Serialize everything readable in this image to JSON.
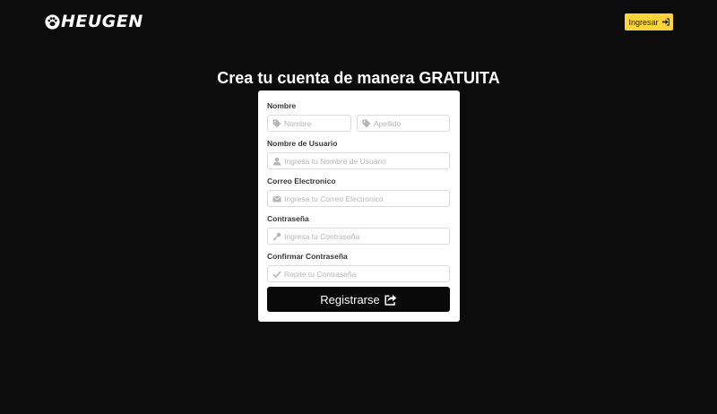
{
  "brand": {
    "name": "HEUGEN",
    "logo_icon": "paw-icon"
  },
  "nav": {
    "login_label": "Ingresar",
    "login_icon": "sign-in-icon",
    "login_color": "#ffd43b"
  },
  "headline": "Crea tu cuenta de manera GRATUITA",
  "form": {
    "name_label": "Nombre",
    "first_name_placeholder": "Nombre",
    "last_name_placeholder": "Apellido",
    "username_label": "Nombre de Usuario",
    "username_placeholder": "Ingresa tu Nombre de Usuario",
    "email_label": "Correo Electronico",
    "email_placeholder": "Ingresa tu Correo Electronico",
    "password_label": "Contraseña",
    "password_placeholder": "Ingresa tu Contraseña",
    "confirm_label": "Confirmar Contraseña",
    "confirm_placeholder": "Repite tu Contraseña",
    "submit_label": "Registrarse",
    "submit_icon": "share-square-icon"
  },
  "colors": {
    "background": "#0c0c0c",
    "card": "#ffffff",
    "button": "#0a0a0a",
    "accent": "#ffd43b"
  }
}
